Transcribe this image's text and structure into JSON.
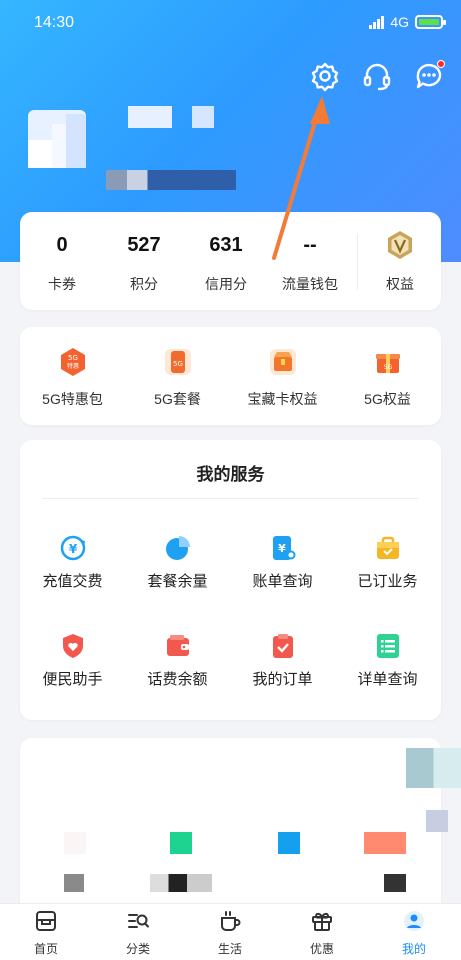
{
  "status_bar": {
    "time": "14:30",
    "network": "4G"
  },
  "top_icons": [
    "gear-icon",
    "headset-icon",
    "message-icon"
  ],
  "stats": [
    {
      "value": "0",
      "label": "卡券"
    },
    {
      "value": "527",
      "label": "积分"
    },
    {
      "value": "631",
      "label": "信用分"
    },
    {
      "value": "--",
      "label": "流量钱包"
    }
  ],
  "rights": {
    "label": "权益",
    "icon": "vip-badge-icon"
  },
  "promos": [
    {
      "label": "5G特惠包",
      "icon": "5g-deal-icon"
    },
    {
      "label": "5G套餐",
      "icon": "5g-plan-icon"
    },
    {
      "label": "宝藏卡权益",
      "icon": "treasure-card-icon"
    },
    {
      "label": "5G权益",
      "icon": "5g-gift-icon"
    }
  ],
  "services": {
    "title": "我的服务",
    "items": [
      {
        "label": "充值交费",
        "icon": "recharge-icon",
        "color": "#1ea1f2"
      },
      {
        "label": "套餐余量",
        "icon": "pie-chart-icon",
        "color": "#1ea1f2"
      },
      {
        "label": "账单查询",
        "icon": "bill-icon",
        "color": "#1ea1f2"
      },
      {
        "label": "已订业务",
        "icon": "briefcase-icon",
        "color": "#f5b623"
      },
      {
        "label": "便民助手",
        "icon": "heart-shield-icon",
        "color": "#f2584d"
      },
      {
        "label": "话费余额",
        "icon": "wallet-icon",
        "color": "#f2584d"
      },
      {
        "label": "我的订单",
        "icon": "clipboard-check-icon",
        "color": "#f2584d"
      },
      {
        "label": "详单查询",
        "icon": "list-icon",
        "color": "#2ed394"
      }
    ]
  },
  "bottom_nav": [
    {
      "label": "首页",
      "icon": "home-icon"
    },
    {
      "label": "分类",
      "icon": "category-icon"
    },
    {
      "label": "生活",
      "icon": "cup-icon"
    },
    {
      "label": "优惠",
      "icon": "gift-icon"
    },
    {
      "label": "我的",
      "icon": "profile-icon",
      "active": true
    }
  ],
  "colors": {
    "accent": "#1a8cff",
    "header": "#2d9bff",
    "arrow": "#f47b36"
  }
}
